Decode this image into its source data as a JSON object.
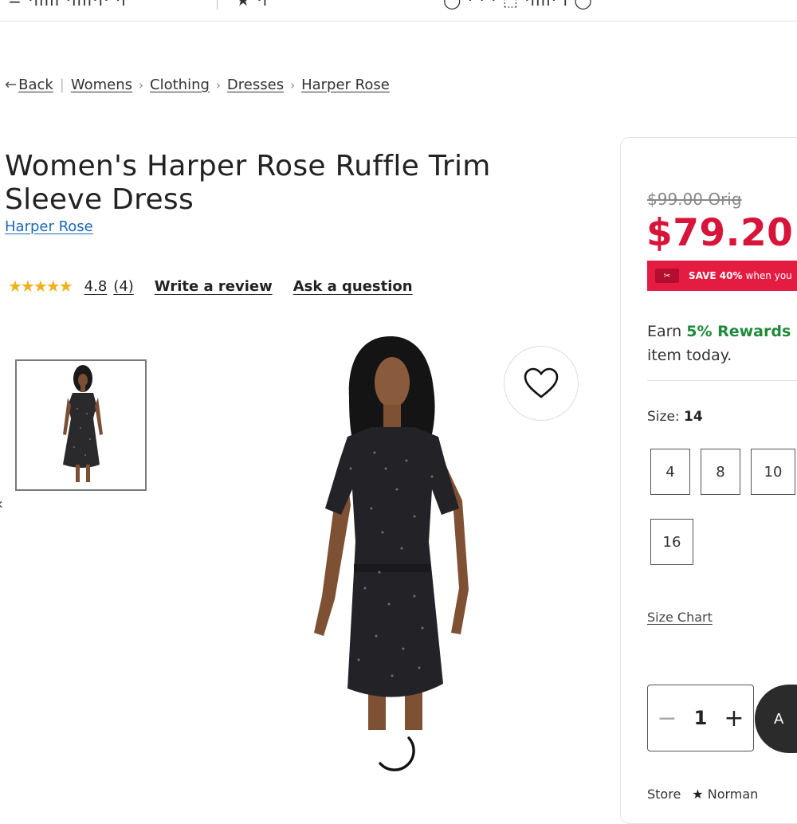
{
  "topbar": {
    "fragment_left": "= ·ııııı ·ıııı·ı· ·ı",
    "fragment_mid": "★ ·ı",
    "fragment_right": "◯ · · · ⬚ ·ıııı· ı ◯"
  },
  "breadcrumb": {
    "back": "Back",
    "items": [
      "Womens",
      "Clothing",
      "Dresses",
      "Harper Rose"
    ]
  },
  "product": {
    "title": "Women's Harper Rose Ruffle Trim Sleeve Dress",
    "brand": "Harper Rose",
    "rating_stars": "★★★★★",
    "rating_value": "4.8",
    "review_count": "(4)",
    "write_review": "Write a review",
    "ask_question": "Ask a question"
  },
  "pricing": {
    "original": "$99.00 Orig",
    "sale": "$79.20",
    "save_strong": "SAVE 40%",
    "save_rest": "when you"
  },
  "rewards": {
    "prefix": "Earn ",
    "highlight": "5% Rewards",
    "line2": "item today."
  },
  "sizes": {
    "label": "Size:",
    "selected": "14",
    "options": [
      "4",
      "8",
      "10",
      "16"
    ],
    "chart_link": "Size Chart"
  },
  "quantity": {
    "value": "1",
    "minus": "−",
    "plus": "+"
  },
  "cart": {
    "label": "A"
  },
  "store": {
    "label": "Store",
    "name": "Norman"
  },
  "colors": {
    "sale": "#d7143a",
    "save_bar": "#e51c42",
    "rewards": "#1f8a3a",
    "brand_link": "#1b69b8",
    "stars": "#f0b21b"
  }
}
